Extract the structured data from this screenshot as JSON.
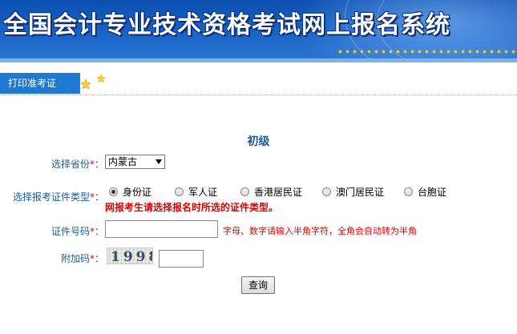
{
  "header": {
    "title": "全国会计专业技术资格考试网上报名系统"
  },
  "nav": {
    "tab_label": "打印准考证"
  },
  "form": {
    "level_title": "初级",
    "province_label": "选择省份",
    "province_value": "内蒙古",
    "id_type_label": "选择报考证件类型",
    "id_types": [
      "身份证",
      "军人证",
      "香港居民证",
      "澳门居民证",
      "台胞证"
    ],
    "id_type_selected": "身份证",
    "id_type_warning": "网报考生请选择报名时所选的证件类型。",
    "id_number_label": "证件号码",
    "id_number_value": "",
    "id_number_hint": "字母、数字请输入半角字符，全角会自动转为半角",
    "captcha_label": "附加码",
    "captcha_text": "1998",
    "captcha_value": "",
    "required_mark": "*",
    "query_button": "查询"
  },
  "colors": {
    "banner": "#1a64c6",
    "nav_tab": "#1e79d2",
    "label": "#1a5fa0",
    "warning": "#e00000"
  }
}
